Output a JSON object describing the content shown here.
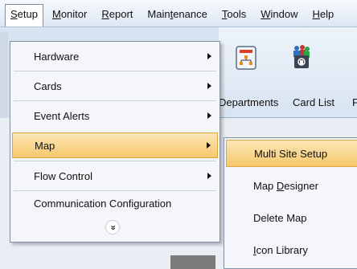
{
  "menubar": {
    "items": [
      {
        "label": "Setup",
        "underline": "S",
        "rest": "etup"
      },
      {
        "label": "Monitor",
        "underline": "M",
        "rest": "onitor"
      },
      {
        "label": "Report",
        "underline": "R",
        "rest": "eport"
      },
      {
        "pre": "Main",
        "underline": "t",
        "rest": "enance",
        "label": "Maintenance"
      },
      {
        "label": "Tools",
        "underline": "T",
        "rest": "ools"
      },
      {
        "label": "Window",
        "underline": "W",
        "rest": "indow"
      },
      {
        "label": "Help",
        "underline": "H",
        "rest": "elp"
      }
    ]
  },
  "toolbar": {
    "departments_label": "Departments",
    "card_list_label": "Card List",
    "partial_label": "F"
  },
  "setup_menu": {
    "items": [
      {
        "label": "Hardware",
        "has_submenu": true
      },
      {
        "label": "Cards",
        "has_submenu": true
      },
      {
        "label": "Event Alerts",
        "has_submenu": true
      },
      {
        "label": "Map",
        "has_submenu": true,
        "highlighted": true
      },
      {
        "label": "Flow Control",
        "has_submenu": true
      },
      {
        "label": "Communication Configuration",
        "has_submenu": false
      }
    ],
    "expand_glyph": "»"
  },
  "map_submenu": {
    "items": [
      {
        "label": "Multi Site Setup",
        "highlighted": true
      },
      {
        "pre": "Map ",
        "underline": "D",
        "rest": "esigner",
        "label": "Map Designer"
      },
      {
        "label": "Delete Map"
      },
      {
        "pre": "",
        "underline": "I",
        "rest": "con Library",
        "label": "Icon Library"
      }
    ]
  },
  "colors": {
    "highlight_top": "#fbe6b6",
    "highlight_bottom": "#f6c86c",
    "menu_bg": "#f4f6f9"
  }
}
